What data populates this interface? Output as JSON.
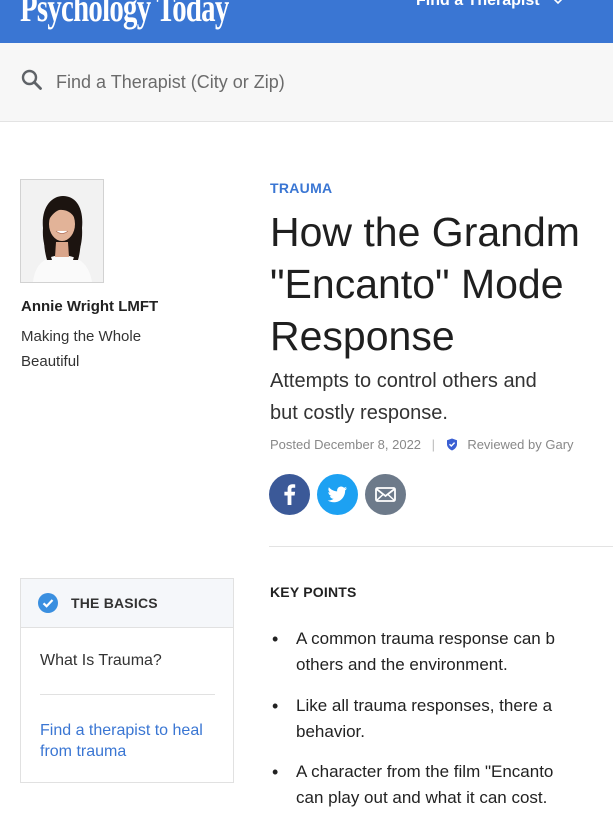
{
  "header": {
    "logo_text": "Psychology Today",
    "nav_find_therapist": "Find a Therapist",
    "brand_color": "#3a76d3"
  },
  "search": {
    "placeholder": "Find a Therapist (City or Zip)"
  },
  "author": {
    "name": "Annie Wright LMFT",
    "tagline": "Making the Whole Beautiful"
  },
  "article": {
    "category": "TRAUMA",
    "headline_lines": [
      "How the Grandm",
      "\"Encanto\" Mode",
      "Response"
    ],
    "subtitle_lines": [
      "Attempts to control others and",
      "but costly response."
    ],
    "posted": "Posted December 8, 2022",
    "separator": "|",
    "reviewed": "Reviewed by Gary"
  },
  "share": {
    "facebook_icon": "facebook-icon",
    "twitter_icon": "twitter-icon",
    "email_icon": "email-icon",
    "colors": {
      "facebook": "#3b5998",
      "twitter": "#1da1f2",
      "email": "#6d7a8a"
    }
  },
  "basics": {
    "title": "THE BASICS",
    "link_what_is": "What Is Trauma?",
    "link_find_therapist": "Find a therapist to heal from trauma"
  },
  "key_points": {
    "title": "KEY POINTS",
    "items": [
      {
        "lines": [
          "A common trauma response can b",
          "others and the environment."
        ]
      },
      {
        "lines": [
          "Like all trauma responses, there a",
          "behavior."
        ]
      },
      {
        "lines": [
          "A character from the film \"Encanto",
          "can play out and what it can cost."
        ]
      }
    ]
  }
}
